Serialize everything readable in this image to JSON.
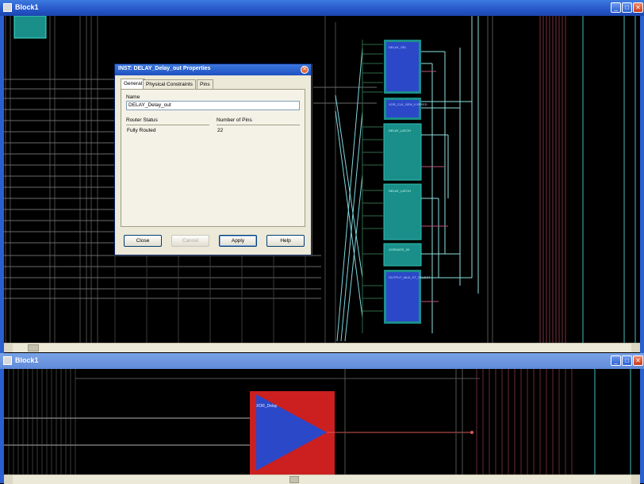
{
  "top_window": {
    "title": "Block1",
    "min_label": "_",
    "max_label": "□",
    "close_label": "✕",
    "title_color": "#2657c8"
  },
  "bottom_window": {
    "title": "Block1",
    "min_label": "_",
    "max_label": "□",
    "close_label": "✕",
    "block_label": "XOR_Delay"
  },
  "schematic": {
    "blocks": [
      {
        "label": "DELAY_SEL",
        "fill": "#2b48c8"
      },
      {
        "label": "XOR_CLK_GEN_0 SPEED",
        "fill": "#2b48c8"
      },
      {
        "label": "DELAY_LATCH",
        "fill": "#1a8f8a"
      },
      {
        "label": "DELAY_LATCH",
        "fill": "#1a8f8a"
      },
      {
        "label": "XORGATE_X0",
        "fill": "#1a8f8a"
      },
      {
        "label": "OUTPUT_MUX_ST_SELECT",
        "fill": "#2b48c8"
      }
    ],
    "module_fill": "#cc1f1f",
    "triangle_fill": "#2b48c8",
    "outline_color": "#1ec8c8"
  },
  "dialog": {
    "title": "INST: DELAY_Delay_out Properties",
    "close_label": "✕",
    "tabs": [
      "General",
      "Physical Constraints",
      "Pins"
    ],
    "active_tab": "General",
    "name_label": "Name",
    "name_value": "DELAY_Delay_out",
    "router_status_label": "Router Status",
    "router_status_value": "Fully Routed",
    "pins_label": "Number of Pins",
    "pins_value": "22",
    "buttons": {
      "close": "Close",
      "cancel": "Cancel",
      "apply": "Apply",
      "help": "Help"
    }
  }
}
